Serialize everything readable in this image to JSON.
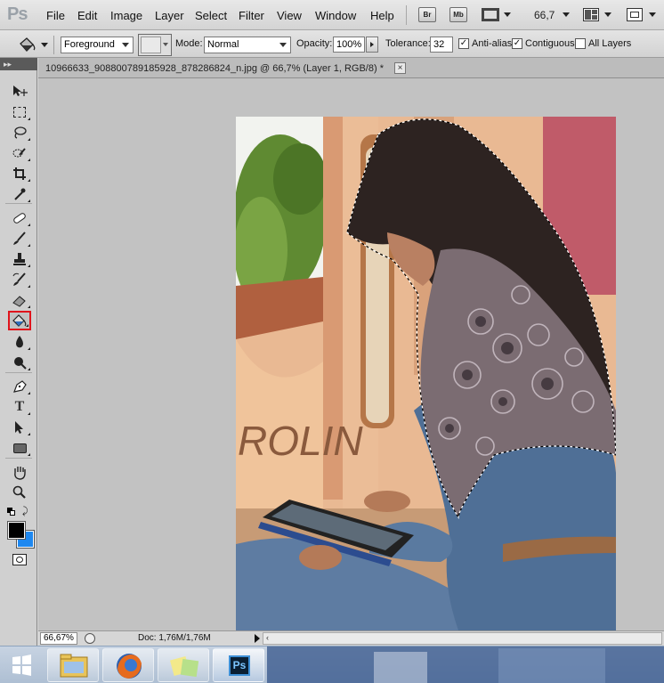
{
  "app": {
    "logo_text": "Ps"
  },
  "menu": {
    "items": [
      "File",
      "Edit",
      "Image",
      "Layer",
      "Select",
      "Filter",
      "View",
      "Window",
      "Help"
    ],
    "bridge_label": "Br",
    "minibridge_label": "Mb",
    "zoom_value": "66,7"
  },
  "options": {
    "fill_source": "Foreground",
    "mode_label": "Mode:",
    "mode_value": "Normal",
    "opacity_label": "Opacity:",
    "opacity_value": "100%",
    "tolerance_label": "Tolerance:",
    "tolerance_value": "32",
    "antialias_label": "Anti-alias",
    "antialias_checked": true,
    "contiguous_label": "Contiguous",
    "contiguous_checked": true,
    "all_layers_label": "All Layers",
    "all_layers_checked": false
  },
  "toolbox": {
    "header": "▸▸",
    "tools": [
      "move",
      "marquee",
      "lasso",
      "quick-selection",
      "crop",
      "eyedropper",
      "spot-healing",
      "brush",
      "clone-stamp",
      "history-brush",
      "eraser",
      "paint-bucket",
      "blur",
      "dodge",
      "pen",
      "type",
      "path-selection",
      "rectangle",
      "hand",
      "zoom"
    ],
    "active_tool": "paint-bucket",
    "foreground_color": "#000000",
    "background_color": "#1e88f0"
  },
  "document": {
    "tab_title": "10966633_908800789185928_878286824_n.jpg @ 66,7% (Layer 1, RGB/8) *",
    "graffiti_text": "ROLIN"
  },
  "status": {
    "zoom": "66,67%",
    "doc_info": "Doc: 1,76M/1,76M"
  },
  "taskbar": {
    "apps": [
      "file-explorer",
      "firefox",
      "sticky-notes",
      "photoshop"
    ],
    "active_app": "photoshop",
    "photoshop_label": "Ps"
  }
}
